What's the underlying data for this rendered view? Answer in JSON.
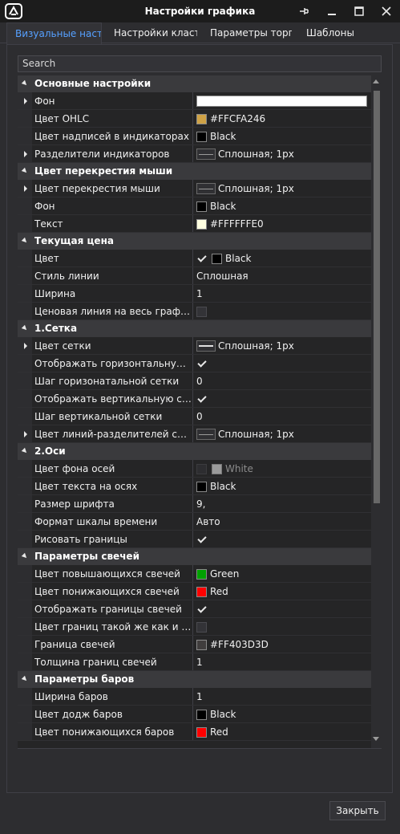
{
  "window": {
    "title": "Настройки графика"
  },
  "tabs": [
    {
      "label": "Визуальные настр"
    },
    {
      "label": "Настройки класте"
    },
    {
      "label": "Параметры торгов"
    },
    {
      "label": "Шаблоны"
    }
  ],
  "search": {
    "placeholder": "Search"
  },
  "categories": [
    {
      "label": "Основные настройки",
      "rows": [
        {
          "label": "Фон",
          "expandable": true,
          "value": "",
          "kind": "wide-swatch",
          "color": "#ffffff"
        },
        {
          "label": "Цвет OHLC",
          "value": "#FFCFA246",
          "kind": "swatch",
          "color": "#cfa246"
        },
        {
          "label": "Цвет надписей в индикаторах",
          "value": "Black",
          "kind": "swatch",
          "color": "#000000"
        },
        {
          "label": "Разделители индикаторов",
          "expandable": true,
          "value": "Сплошная; 1px",
          "kind": "line"
        }
      ]
    },
    {
      "label": "Цвет перекрестия мыши",
      "rows": [
        {
          "label": "Цвет перекрестия мыши",
          "expandable": true,
          "value": "Сплошная; 1px",
          "kind": "line"
        },
        {
          "label": "Фон",
          "value": "Black",
          "kind": "swatch",
          "color": "#000000"
        },
        {
          "label": "Текст",
          "value": "#FFFFFFE0",
          "kind": "swatch",
          "color": "#ffffe0"
        }
      ]
    },
    {
      "label": "Текущая цена",
      "rows": [
        {
          "label": "Цвет",
          "value": "Black",
          "kind": "check-swatch",
          "checked": true,
          "color": "#000000"
        },
        {
          "label": "Стиль линии",
          "value": "Сплошная",
          "kind": "text"
        },
        {
          "label": "Ширина",
          "value": "1",
          "kind": "text"
        },
        {
          "label": "Ценовая линия на весь график",
          "value": "",
          "kind": "checkbox",
          "checked": false
        }
      ]
    },
    {
      "label": "1.Сетка",
      "rows": [
        {
          "label": "Цвет сетки",
          "expandable": true,
          "value": "Сплошная; 1px",
          "kind": "line-light"
        },
        {
          "label": "Отображать горизонтальную с...",
          "value": "",
          "kind": "checkbox",
          "checked": true
        },
        {
          "label": "Шаг горизонатальной сетки",
          "value": "0",
          "kind": "text"
        },
        {
          "label": "Отображать вертикальную сетку",
          "value": "",
          "kind": "checkbox",
          "checked": true
        },
        {
          "label": "Шаг вертикальной сетки",
          "value": "0",
          "kind": "text"
        },
        {
          "label": "Цвет линий-разделителей сесс...",
          "expandable": true,
          "value": "Сплошная; 1px",
          "kind": "line"
        }
      ]
    },
    {
      "label": "2.Оси",
      "rows": [
        {
          "label": "Цвет фона осей",
          "value": "White",
          "kind": "check-swatch-disabled",
          "checked": false,
          "color": "#9a9a9a"
        },
        {
          "label": "Цвет текста на осях",
          "value": "Black",
          "kind": "swatch",
          "color": "#000000"
        },
        {
          "label": "Размер шрифта",
          "value": "9,",
          "kind": "text"
        },
        {
          "label": "Формат шкалы времени",
          "value": "Авто",
          "kind": "text"
        },
        {
          "label": "Рисовать границы",
          "value": "",
          "kind": "checkbox",
          "checked": true
        }
      ]
    },
    {
      "label": "Параметры свечей",
      "rows": [
        {
          "label": "Цвет повышающихся свечей",
          "value": "Green",
          "kind": "swatch",
          "color": "#00a000"
        },
        {
          "label": "Цвет понижающихся свечей",
          "value": "Red",
          "kind": "swatch",
          "color": "#ff0000"
        },
        {
          "label": "Отображать границы свечей",
          "value": "",
          "kind": "checkbox",
          "checked": true
        },
        {
          "label": "Цвет границ такой же как и тела",
          "value": "",
          "kind": "checkbox",
          "checked": false
        },
        {
          "label": "Граница свечей",
          "value": "#FF403D3D",
          "kind": "swatch",
          "color": "#403d3d"
        },
        {
          "label": "Толщина границ свечей",
          "value": "1",
          "kind": "text"
        }
      ]
    },
    {
      "label": "Параметры баров",
      "rows": [
        {
          "label": "Ширина баров",
          "value": "1",
          "kind": "text"
        },
        {
          "label": "Цвет додж баров",
          "value": "Black",
          "kind": "swatch",
          "color": "#000000"
        },
        {
          "label": "Цвет понижающихся баров",
          "value": "Red",
          "kind": "swatch",
          "color": "#ff0000"
        }
      ]
    }
  ],
  "footer": {
    "close_label": "Закрыть"
  },
  "colors": {
    "accent": "#56a0ff",
    "background": "#2d2d30",
    "grid_bg": "#252526",
    "category_bg": "#3a3a3d"
  },
  "icons": [
    "app-logo-icon",
    "pin-icon",
    "minimize-icon",
    "maximize-icon",
    "close-icon",
    "collapse-triangle-icon",
    "expand-arrow-icon",
    "checkmark-icon",
    "scroll-up-icon",
    "scroll-down-icon"
  ]
}
